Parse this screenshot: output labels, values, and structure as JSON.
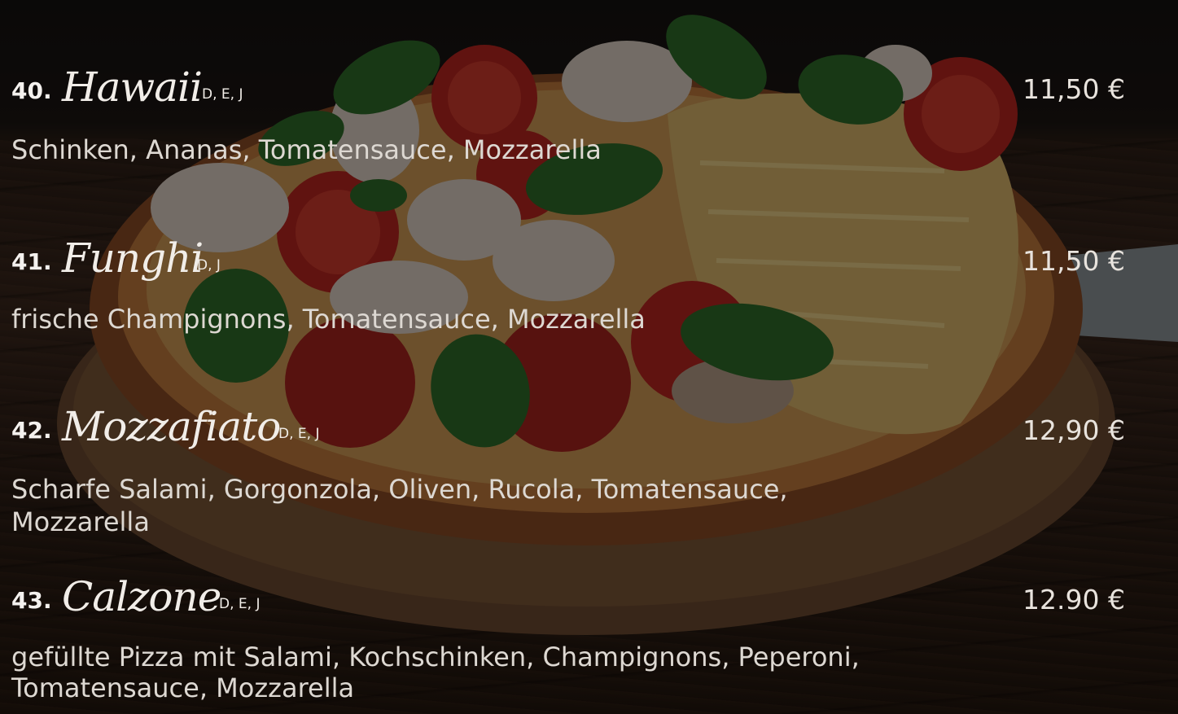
{
  "menu": {
    "items": [
      {
        "number": "40.",
        "name": "Hawaii",
        "allergens": "D, E, J",
        "price": "11,50 €",
        "description": "Schinken, Ananas, Tomatensauce, Mozzarella"
      },
      {
        "number": "41.",
        "name": "Funghi",
        "allergens": "D, J",
        "price": "11,50 €",
        "description": "frische Champignons, Tomatensauce, Mozzarella"
      },
      {
        "number": "42.",
        "name": "Mozzafiato",
        "allergens": "D, E, J",
        "price": "12,90 €",
        "description": "Scharfe Salami, Gorgonzola, Oliven, Rucola, Tomatensauce, Mozzarella"
      },
      {
        "number": "43.",
        "name": "Calzone",
        "allergens": "D, E, J",
        "price": "12.90 €",
        "description": "gefüllte Pizza mit Salami, Kochschinken, Champignons, Peperoni, Tomatensauce, Mozzarella"
      }
    ]
  },
  "colors": {
    "text": "#e6e1dc",
    "overlay": "#000000",
    "wood": "#3a271c",
    "crust": "#8a4b26",
    "cheese": "#c9a25a",
    "tomato": "#b8261f",
    "basil": "#2f6b2a"
  }
}
